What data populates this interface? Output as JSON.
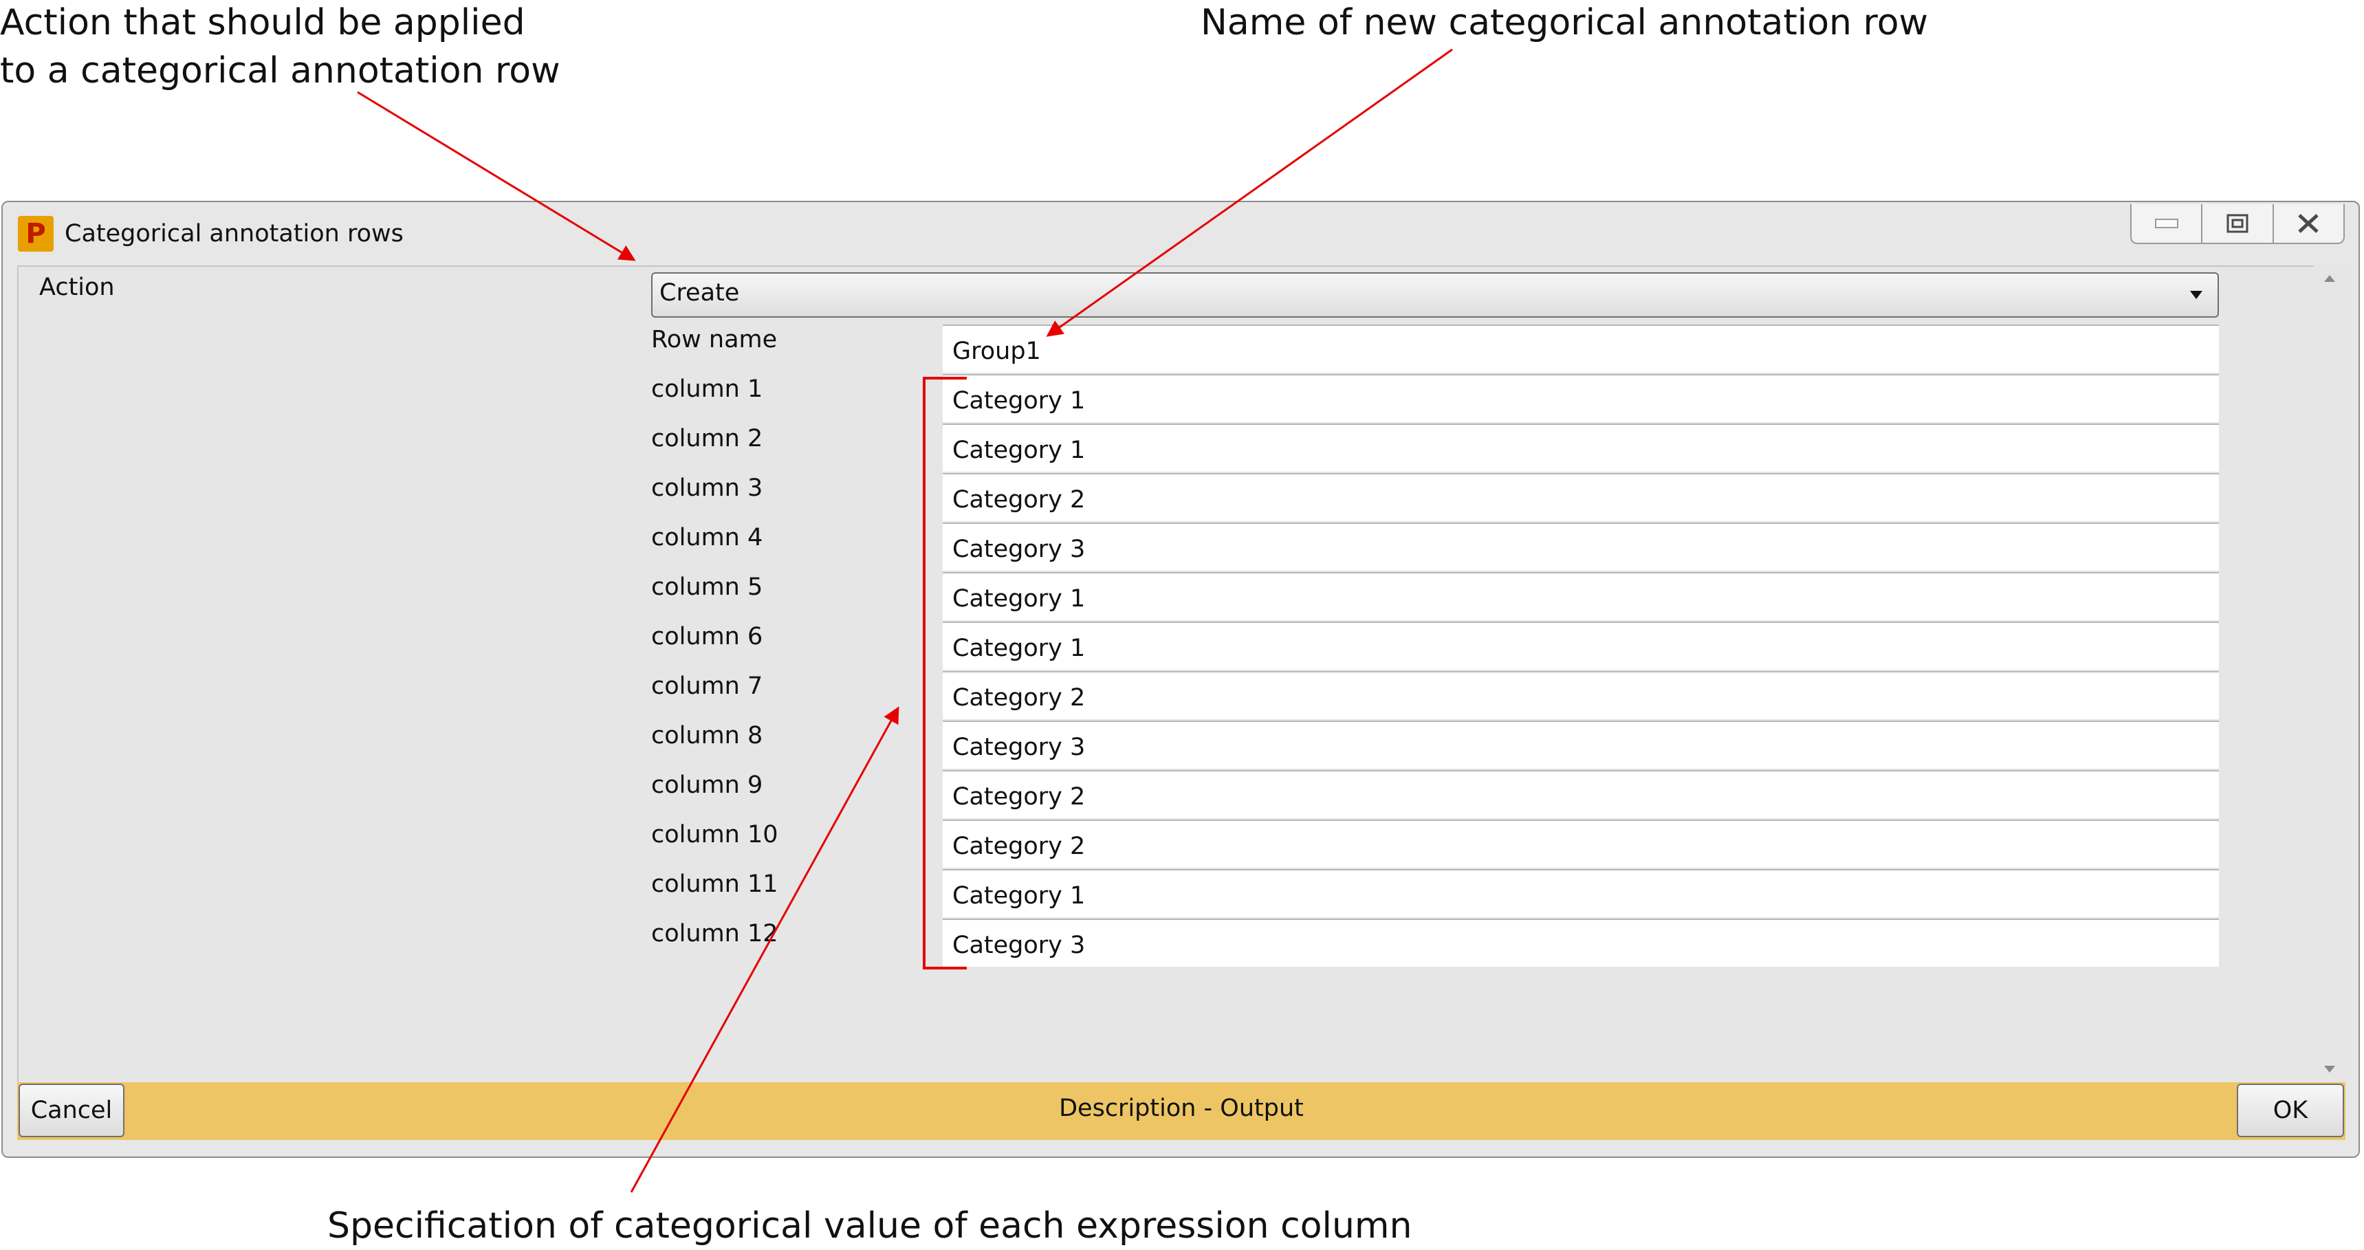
{
  "annotations": {
    "action_line1": "Action that should be applied",
    "action_line2": "to a categorical annotation row",
    "row_name": "Name of new categorical annotation row",
    "specification": "Specification of categorical value of each expression column",
    "color": "#e60000"
  },
  "window": {
    "title": "Categorical annotation rows",
    "app_icon": "perseus-p-icon",
    "controls": [
      "minimize-icon",
      "restore-icon",
      "close-icon"
    ]
  },
  "form": {
    "action_label": "Action",
    "action_value": "Create",
    "row_name_label": "Row name",
    "row_name_value": "Group1",
    "columns": [
      {
        "label": "column 1",
        "value": "Category 1"
      },
      {
        "label": "column 2",
        "value": "Category 1"
      },
      {
        "label": "column 3",
        "value": "Category 2"
      },
      {
        "label": "column 4",
        "value": "Category 3"
      },
      {
        "label": "column 5",
        "value": "Category 1"
      },
      {
        "label": "column 6",
        "value": "Category 1"
      },
      {
        "label": "column 7",
        "value": "Category 2"
      },
      {
        "label": "column 8",
        "value": "Category 3"
      },
      {
        "label": "column 9",
        "value": "Category 2"
      },
      {
        "label": "column 10",
        "value": "Category 2"
      },
      {
        "label": "column 11",
        "value": "Category 1"
      },
      {
        "label": "column 12",
        "value": "Category 3"
      }
    ]
  },
  "footer": {
    "cancel_label": "Cancel",
    "status_text": "Description - Output",
    "ok_label": "OK",
    "status_color": "#edc565"
  }
}
